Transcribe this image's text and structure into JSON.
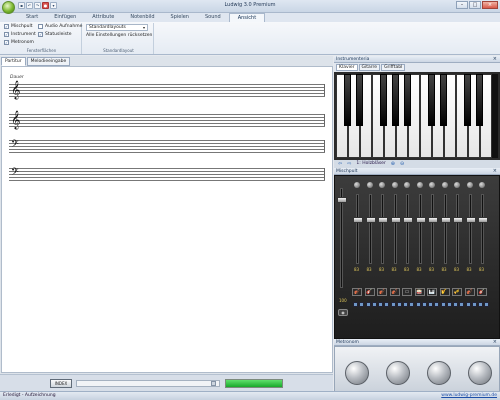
{
  "window": {
    "title": "Ludwig 3.0 Premium"
  },
  "menu_tabs": [
    "Start",
    "Einfügen",
    "Attribute",
    "Notenbild",
    "Spielen",
    "Sound",
    "Ansicht"
  ],
  "ribbon": {
    "fensterflaechen": {
      "label": "Fensterflächen",
      "options": [
        {
          "label": "Mischpult",
          "checked": true
        },
        {
          "label": "Audio Aufnahme",
          "checked": false
        },
        {
          "label": "Instrument",
          "checked": true
        },
        {
          "label": "Statusleiste",
          "checked": true
        },
        {
          "label": "Metronom",
          "checked": true
        }
      ]
    },
    "standardlayout": {
      "label": "Standardlayout",
      "dropdown_value": "Standardlayouts",
      "reset_label": "Alle Einstellungen rücksetzen"
    }
  },
  "document": {
    "tabs": [
      "Partitur",
      "Melodieeingabe"
    ],
    "active_tab": "Partitur",
    "tempo_mark": "Dauer",
    "clefs": [
      "treble",
      "treble",
      "bass",
      "bass"
    ],
    "clef_glyphs": [
      "𝄞",
      "𝄞",
      "𝄢",
      "𝄢"
    ]
  },
  "playback": {
    "button_label": "INDEX",
    "progress": 1.0
  },
  "instrument_panel": {
    "title": "Instrumenteria",
    "tabs": [
      "Klavier",
      "Gitarre",
      "Grifftabl"
    ],
    "active_tab": "Klavier",
    "current_instrument": "1: Holzbläser"
  },
  "mixer": {
    "title": "Mischpult",
    "channel_count": 11,
    "channel_values": [
      "83",
      "83",
      "83",
      "83",
      "83",
      "83",
      "83",
      "83",
      "83",
      "83",
      "83"
    ],
    "master_value": "100",
    "instrument_icons": [
      "🎻",
      "🎸",
      "🎻",
      "🎻",
      "▭",
      "🥁",
      "🎹",
      "🎷",
      "🎺",
      "🎻",
      "🎸"
    ]
  },
  "metronom": {
    "title": "Metronom",
    "dial_count": 4
  },
  "statusbar": {
    "left": "Erledigt - Aufzeichnung",
    "right": "www.ludwig-premium.de"
  },
  "colors": {
    "progress_green": "#18a82a",
    "accent_blue": "#1d4fa8"
  }
}
